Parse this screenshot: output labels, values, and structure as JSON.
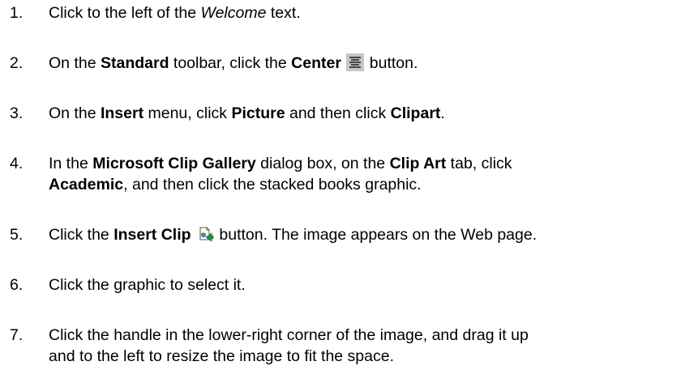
{
  "steps": [
    {
      "number": "1.",
      "parts": [
        "Click to the left of the ",
        "Welcome",
        " text."
      ]
    },
    {
      "number": "2.",
      "parts": [
        "On the ",
        "Standard",
        " toolbar, click the ",
        "Center",
        "button."
      ],
      "icon": "center-align-icon"
    },
    {
      "number": "3.",
      "parts": [
        "On the ",
        "Insert",
        " menu, click ",
        "Picture",
        " and then click ",
        "Clipart",
        "."
      ]
    },
    {
      "number": "4.",
      "parts": [
        "In the ",
        "Microsoft Clip Gallery",
        " dialog box, on the ",
        "Clip Art",
        " tab, click",
        "Academic",
        ", and then click the stacked books graphic."
      ]
    },
    {
      "number": "5.",
      "parts": [
        "Click the ",
        "Insert Clip",
        "button. The image appears on the Web page."
      ],
      "icon": "insert-clip-icon"
    },
    {
      "number": "6.",
      "parts": [
        "Click the graphic to select it."
      ]
    },
    {
      "number": "7.",
      "parts": [
        "Click the handle in the lower-right corner of the image, and drag it up",
        "and to the left to resize the image to fit the space."
      ]
    }
  ]
}
